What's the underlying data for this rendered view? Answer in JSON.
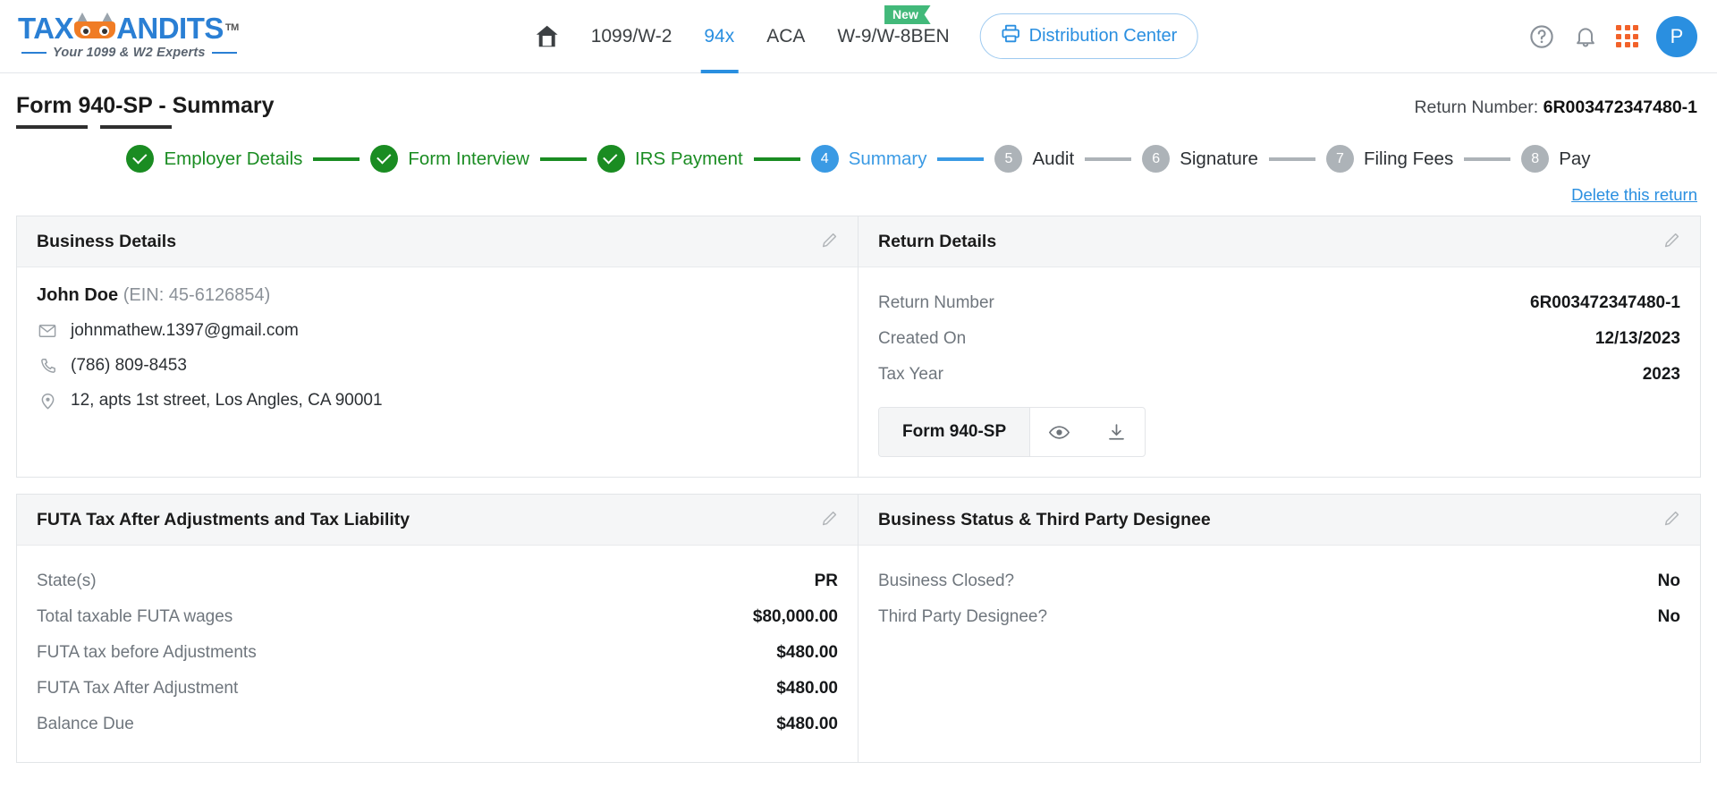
{
  "brand": {
    "name_part1": "TAX",
    "name_part2": "ANDITS",
    "tm": "TM",
    "tagline": "Your 1099 & W2 Experts"
  },
  "nav": {
    "home_icon": "home-icon",
    "items": [
      {
        "label": "1099/W-2",
        "active": false
      },
      {
        "label": "94x",
        "active": true
      },
      {
        "label": "ACA",
        "active": false
      },
      {
        "label": "W-9/W-8BEN",
        "active": false,
        "badge": "New"
      }
    ],
    "distribution_button": "Distribution Center",
    "help_icon": "question-circle-icon",
    "bell_icon": "bell-icon",
    "apps_icon": "grid-apps-icon",
    "avatar_initial": "P"
  },
  "header": {
    "page_title": "Form 940-SP - Summary",
    "return_number_label": "Return Number:",
    "return_number_value": "6R003472347480-1",
    "delete_link": "Delete this return"
  },
  "stepper": {
    "steps": [
      {
        "number": "1",
        "label": "Employer Details",
        "state": "done"
      },
      {
        "number": "2",
        "label": "Form Interview",
        "state": "done"
      },
      {
        "number": "3",
        "label": "IRS Payment",
        "state": "done"
      },
      {
        "number": "4",
        "label": "Summary",
        "state": "current"
      },
      {
        "number": "5",
        "label": "Audit",
        "state": "todo"
      },
      {
        "number": "6",
        "label": "Signature",
        "state": "todo"
      },
      {
        "number": "7",
        "label": "Filing Fees",
        "state": "todo"
      },
      {
        "number": "8",
        "label": "Pay",
        "state": "todo"
      }
    ]
  },
  "business_details": {
    "title": "Business Details",
    "edit_icon": "pencil-icon",
    "name": "John Doe",
    "ein": "(EIN: 45-6126854)",
    "email": "johnmathew.1397@gmail.com",
    "phone": "(786) 809-8453",
    "address": "12, apts 1st street, Los Angles, CA 90001"
  },
  "return_details": {
    "title": "Return Details",
    "edit_icon": "pencil-icon",
    "rows": [
      {
        "label": "Return Number",
        "value": "6R003472347480-1"
      },
      {
        "label": "Created On",
        "value": "12/13/2023"
      },
      {
        "label": "Tax Year",
        "value": "2023"
      }
    ],
    "form_chip": {
      "name": "Form 940-SP",
      "view_icon": "eye-icon",
      "download_icon": "download-icon"
    }
  },
  "futa": {
    "title": "FUTA Tax After Adjustments and Tax Liability",
    "edit_icon": "pencil-icon",
    "rows": [
      {
        "label": "State(s)",
        "value": "PR"
      },
      {
        "label": "Total taxable FUTA wages",
        "value": "$80,000.00"
      },
      {
        "label": "FUTA tax before Adjustments",
        "value": "$480.00"
      },
      {
        "label": "FUTA Tax After Adjustment",
        "value": "$480.00"
      },
      {
        "label": "Balance Due",
        "value": "$480.00"
      }
    ]
  },
  "business_status": {
    "title": "Business Status & Third Party Designee",
    "edit_icon": "pencil-icon",
    "rows": [
      {
        "label": "Business Closed?",
        "value": "No"
      },
      {
        "label": "Third Party Designee?",
        "value": "No"
      }
    ]
  },
  "colors": {
    "brand_blue": "#2a7fd4",
    "accent_blue": "#2a8fe0",
    "brand_orange": "#f07c25",
    "done_green": "#1a8c22",
    "badge_green": "#42b97a",
    "todo_gray": "#adb3b8"
  }
}
